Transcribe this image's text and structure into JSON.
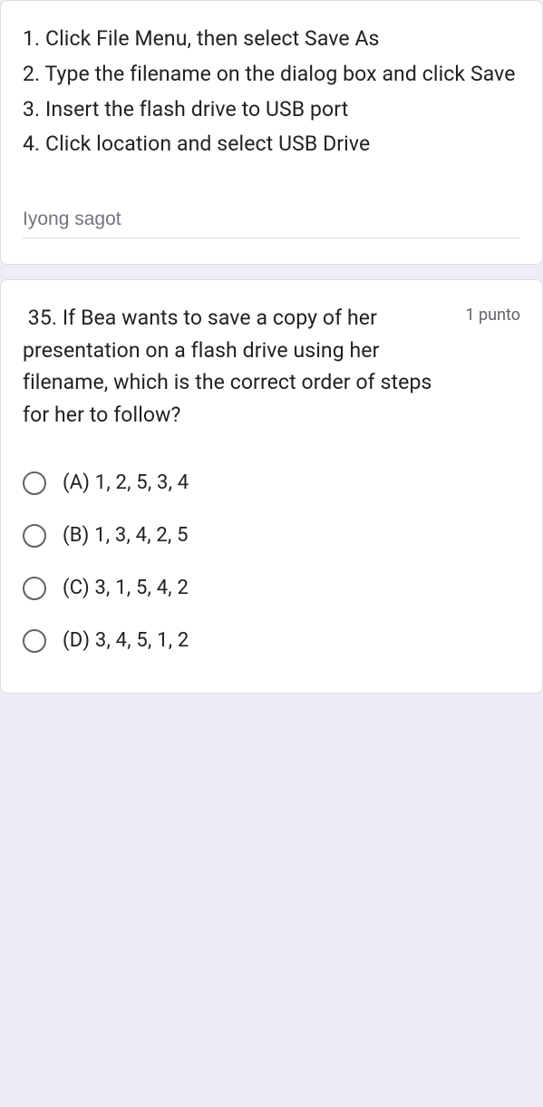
{
  "prev_question": {
    "steps": [
      "1. Click File Menu, then select Save As",
      "2. Type the filename on the dialog box and click Save",
      "3. Insert the flash drive to USB port",
      "4. Click location and select USB Drive"
    ],
    "answer_placeholder": "Iyong sagot"
  },
  "question": {
    "number_and_text": " 35. If Bea wants to save a copy of her presentation on a flash drive using her filename, which is the correct order of steps for her to follow?",
    "points": "1 punto",
    "options": [
      "(A) 1, 2, 5, 3, 4",
      "(B) 1, 3, 4, 2, 5",
      "(C) 3, 1, 5, 4, 2",
      "(D) 3, 4, 5, 1, 2"
    ]
  }
}
